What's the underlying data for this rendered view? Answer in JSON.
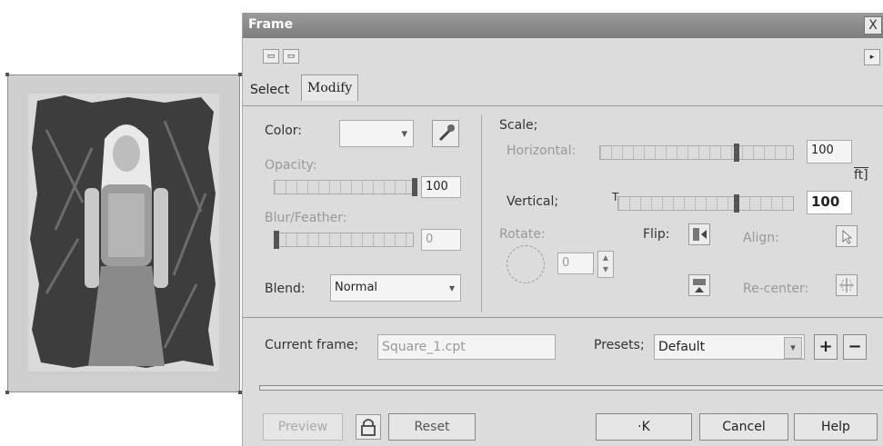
{
  "dialog": {
    "title": "Frame",
    "close_glyph": "X",
    "tabs": {
      "select": "Select",
      "modify": "Modify"
    },
    "color_label": "Color:",
    "color_dropdown_glyph": "▾",
    "opacity_label": "Opacity:",
    "opacity_value": "100",
    "blur_label": "Blur/Feather:",
    "blur_value": "0",
    "blend_label": "Blend:",
    "blend_value": "Normal",
    "scale_label": "Scale;",
    "horizontal_label": "Horizontal:",
    "horizontal_value": "100",
    "vertical_label": "Vertical;",
    "vertical_value": "100",
    "ft_text": "ft]",
    "slider_mark": "T",
    "rotate_label": "Rotate:",
    "rotate_value": "0",
    "flip_label": "Flip:",
    "align_label": "Align:",
    "recenter_label": "Re-center:",
    "current_frame_label": "Current frame;",
    "current_frame_value": "Square_1.cpt",
    "presets_label": "Presets;",
    "presets_value": "Default",
    "add_glyph": "+",
    "remove_glyph": "−",
    "buttons": {
      "preview": "Preview",
      "reset": "Reset",
      "ok": "·K",
      "cancel": "Cancel",
      "help": "Help"
    }
  },
  "icons": {
    "toolbar": [
      "toolbar-icon-1",
      "toolbar-icon-2"
    ],
    "eyedropper": "eyedropper-icon",
    "lock": "lock-icon"
  }
}
